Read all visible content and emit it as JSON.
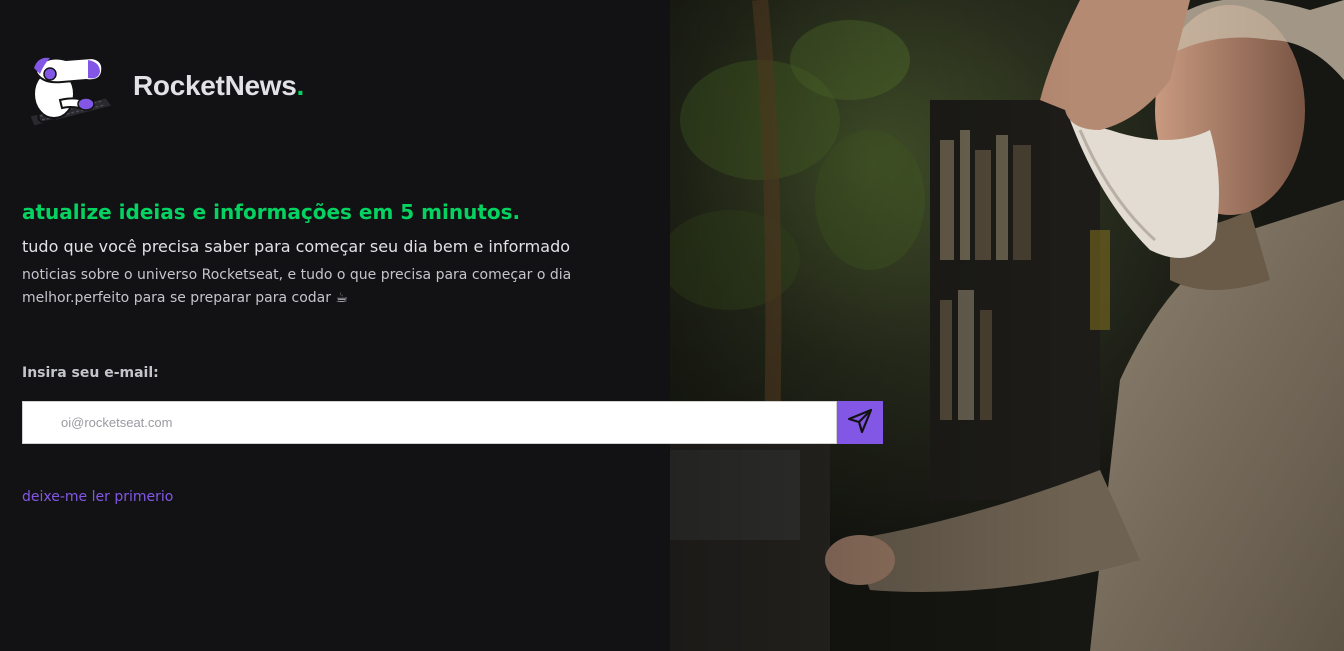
{
  "brand": {
    "name": "RocketNews",
    "dot": "."
  },
  "hero": {
    "headline": "atualize ideias e informações em 5 minutos.",
    "subheadline": "tudo que você precisa saber para começar seu dia bem e informado",
    "description": "noticias sobre o universo Rocketseat, e tudo o que precisa para começar o dia melhor.perfeito para se preparar para codar ☕"
  },
  "form": {
    "email_label": "Insira seu e-mail:",
    "email_placeholder": "oi@rocketseat.com",
    "email_value": "",
    "send_icon": "paper-plane-icon"
  },
  "links": {
    "read_first": "deixe-me ler primerio"
  },
  "colors": {
    "background": "#121214",
    "accent_green": "#04d361",
    "accent_purple": "#8257e5",
    "text_primary": "#e1e1e6",
    "text_secondary": "#c4c4cc"
  },
  "icons": {
    "logo": "astronaut-keyboard-logo-icon"
  }
}
